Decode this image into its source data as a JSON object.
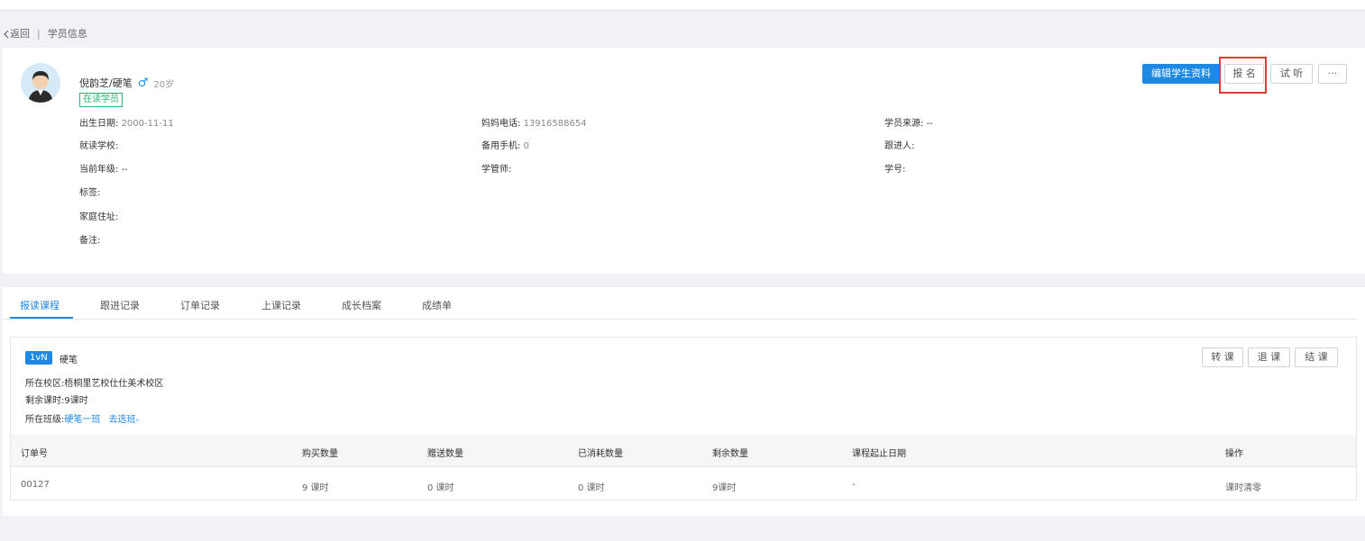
{
  "breadcrumb": {
    "back_label": "返回",
    "page_title": "学员信息"
  },
  "student": {
    "name": "倪韵芝/硬笔",
    "gender_icon": "male-icon",
    "age": "20岁",
    "status": "在读学员"
  },
  "fields": {
    "birth": {
      "label": "出生日期:",
      "value": "2000-11-11"
    },
    "mom_phone": {
      "label": "妈妈电话:",
      "value": "13916588654"
    },
    "source": {
      "label": "学员来源:",
      "value": "--"
    },
    "school": {
      "label": "就读学校:",
      "value": ""
    },
    "backup_phone": {
      "label": "备用手机:",
      "value": "0"
    },
    "follower": {
      "label": "跟进人:",
      "value": ""
    },
    "grade": {
      "label": "当前年级:",
      "value": "--"
    },
    "manager": {
      "label": "学管师:",
      "value": ""
    },
    "student_no": {
      "label": "学号:",
      "value": ""
    },
    "tags": {
      "label": "标签:",
      "value": ""
    },
    "address": {
      "label": "家庭住址:",
      "value": ""
    },
    "remark": {
      "label": "备注:",
      "value": ""
    }
  },
  "actions": {
    "edit": "编辑学生资料",
    "enroll": "报 名",
    "trial": "试 听",
    "more": "···"
  },
  "tabs": [
    "报读课程",
    "跟进记录",
    "订单记录",
    "上课记录",
    "成长档案",
    "成绩单"
  ],
  "course": {
    "badge": "1vN",
    "name": "硬笔",
    "campus_label": "所在校区:",
    "campus": "梧桐里艺校仕仕美术校区",
    "remaining_label": "剩余课时:",
    "remaining": "9课时",
    "class_label": "所在班级:",
    "class_name": "硬笔一班",
    "choose_class": "去选班",
    "buttons": {
      "transfer": "转 课",
      "refund": "退 课",
      "finish": "结 课"
    }
  },
  "table": {
    "headers": [
      "订单号",
      "购买数量",
      "赠送数量",
      "已消耗数量",
      "剩余数量",
      "课程起止日期",
      "操作"
    ],
    "rows": [
      {
        "order": "00127",
        "bought": "9 课时",
        "gift": "0 课时",
        "consumed": "0 课时",
        "remaining": "9课时",
        "dates": "-",
        "action": "课时清零"
      }
    ]
  },
  "colors": {
    "primary": "#1e88e5",
    "status_green": "#2bb673",
    "highlight_red": "#e53935"
  }
}
